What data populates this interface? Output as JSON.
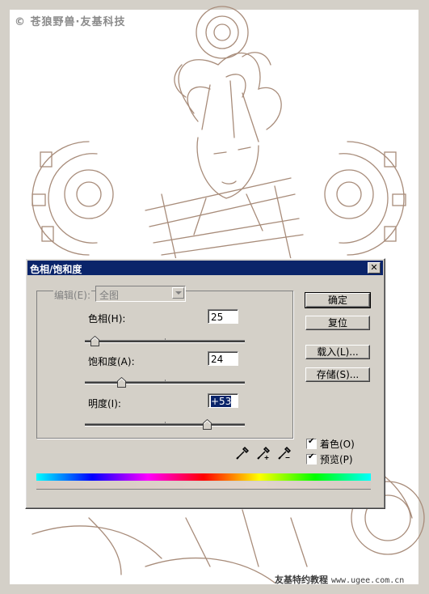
{
  "watermarks": {
    "top": "© 苍狼野兽·友基科技",
    "bottom_text": "友基特约教程",
    "bottom_url": "www.ugee.com.cn"
  },
  "dialog": {
    "title": "色相/饱和度",
    "close_label": "✕",
    "edit_label": "编辑(E):",
    "edit_value": "全图",
    "hue_label": "色相(H):",
    "hue_value": "25",
    "saturation_label": "饱和度(A):",
    "saturation_value": "24",
    "lightness_label": "明度(I):",
    "lightness_value": "+53",
    "ok_label": "确定",
    "reset_label": "复位",
    "load_label": "载入(L)...",
    "save_label": "存储(S)...",
    "colorize_label": "着色(O)",
    "preview_label": "预览(P)",
    "colorize_checked": true,
    "preview_checked": true
  },
  "colors": {
    "title_bar": "#0a246a",
    "dialog_bg": "#d4d0c8",
    "line_art": "#a88c7a"
  },
  "icons": [
    "eyedropper-icon",
    "eyedropper-plus-icon",
    "eyedropper-minus-icon"
  ]
}
